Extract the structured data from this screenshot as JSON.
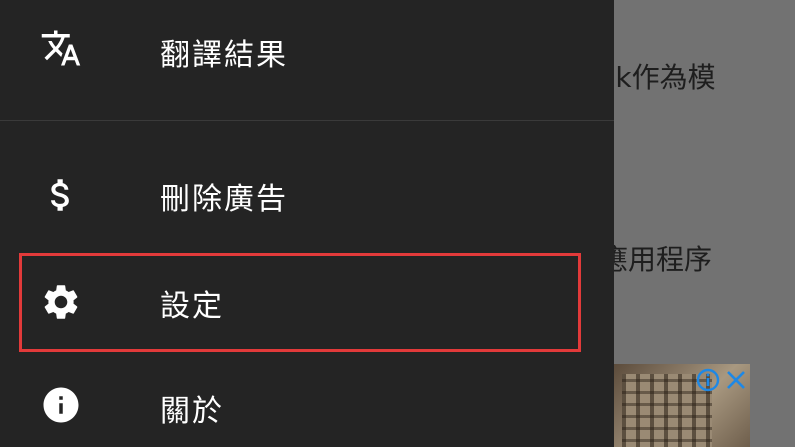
{
  "background": {
    "text_line_1": "ck作為模",
    "text_line_2": "應用程序"
  },
  "drawer": {
    "items": [
      {
        "label": "翻譯結果",
        "icon": "translate-icon"
      },
      {
        "label": "刪除廣告",
        "icon": "dollar-icon"
      },
      {
        "label": "設定",
        "icon": "gear-icon"
      },
      {
        "label": "關於",
        "icon": "info-icon"
      }
    ]
  },
  "highlight": {
    "target": "settings",
    "color": "#e23a3a"
  },
  "ad": {
    "info_icon": "ad-info-icon",
    "close_icon": "ad-close-icon",
    "accent": "#1e88e5"
  }
}
